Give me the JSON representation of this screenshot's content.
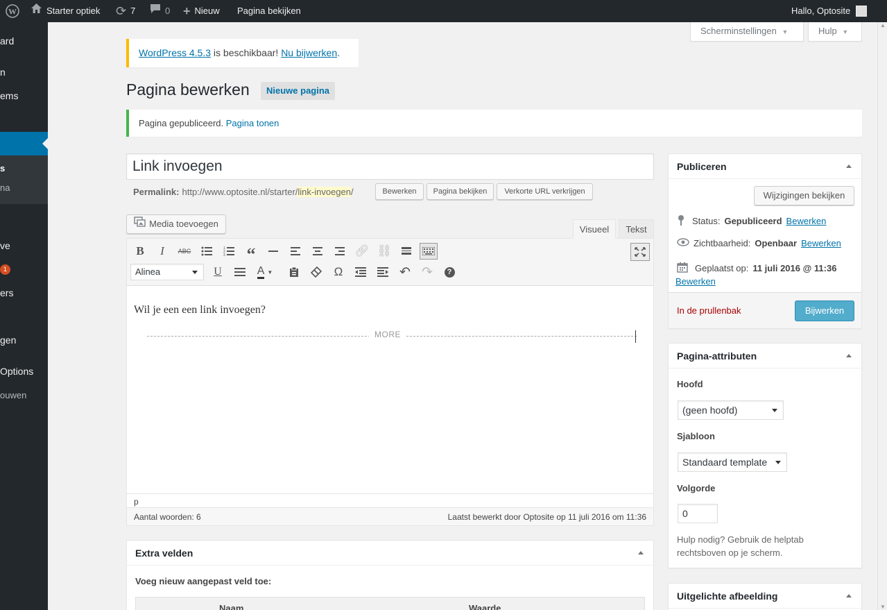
{
  "adminbar": {
    "site_name": "Starter optiek",
    "updates_count": "7",
    "comments_count": "0",
    "new_label": "Nieuw",
    "view_page": "Pagina bekijken",
    "greeting": "Hallo, Optosite"
  },
  "sidebar": {
    "items": [
      "ard",
      "n",
      "ems",
      "s",
      "na",
      "ve",
      "1",
      "ers",
      "gen",
      "Options",
      "ouwen"
    ]
  },
  "screen_options": "Scherminstellingen",
  "help": "Hulp",
  "update_notice": {
    "link1": "WordPress 4.5.3",
    "text": " is beschikbaar! ",
    "link2": "Nu bijwerken",
    "end": "."
  },
  "page_title": "Pagina bewerken",
  "new_page_button": "Nieuwe pagina",
  "published_notice": {
    "text": "Pagina gepubliceerd. ",
    "link": "Pagina tonen"
  },
  "post_title": "Link invoegen",
  "permalink": {
    "label": "Permalink:",
    "base": "http://www.optosite.nl/starter/",
    "slug": "link-invoegen",
    "trail": "/",
    "edit": "Bewerken",
    "view": "Pagina bekijken",
    "shortlink": "Verkorte URL verkrijgen"
  },
  "editor": {
    "add_media": "Media toevoegen",
    "tab_visual": "Visueel",
    "tab_text": "Tekst",
    "format_select": "Alinea",
    "content": "Wil je een een link invoegen?",
    "more": "MORE",
    "path": "p",
    "word_count": "Aantal woorden: 6",
    "last_edited": "Laatst bewerkt door Optosite op 11 juli 2016 om 11:36"
  },
  "custom_fields": {
    "title": "Extra velden",
    "add_label": "Voeg nieuw aangepast veld toe:",
    "col_name": "Naam",
    "col_value": "Waarde"
  },
  "publish": {
    "title": "Publiceren",
    "preview_changes": "Wijzigingen bekijken",
    "status_label": "Status:",
    "status_value": "Gepubliceerd",
    "visibility_label": "Zichtbaarheid:",
    "visibility_value": "Openbaar",
    "published_on_label": "Geplaatst op:",
    "published_on_value": "11 juli 2016 @ 11:36",
    "edit": "Bewerken",
    "trash": "In de prullenbak",
    "update": "Bijwerken"
  },
  "page_attributes": {
    "title": "Pagina-attributen",
    "parent_label": "Hoofd",
    "parent_value": "(geen hoofd)",
    "template_label": "Sjabloon",
    "template_value": "Standaard template",
    "order_label": "Volgorde",
    "order_value": "0",
    "help": "Hulp nodig? Gebruik de helptab rechtsboven op je scherm."
  },
  "featured_image": {
    "title": "Uitgelichte afbeelding"
  },
  "colors": {
    "adminbar_bg": "#23282d",
    "accent": "#0073aa",
    "update_notice_border": "#ffb900",
    "success_border": "#46b450",
    "primary_button": "#52accc",
    "trash_red": "#a00"
  }
}
